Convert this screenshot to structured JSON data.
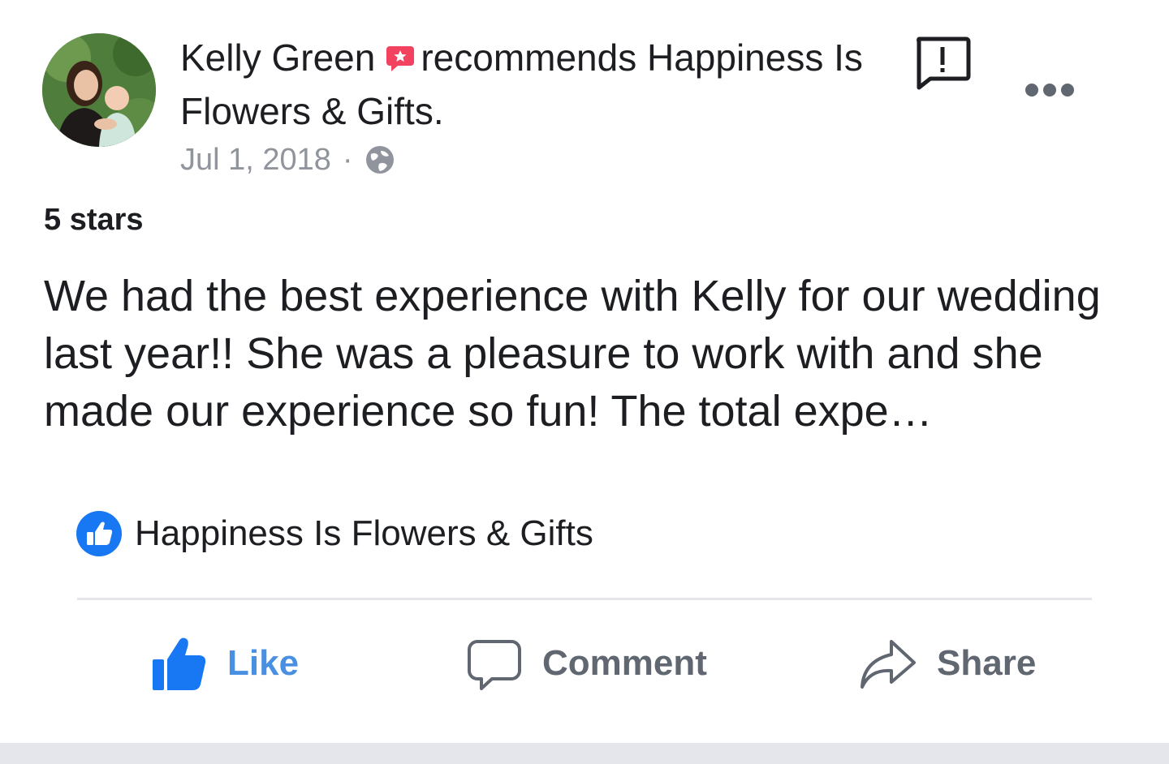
{
  "post": {
    "author": "Kelly Green",
    "action_text": "recommends Happiness Is Flowers & Gifts.",
    "date": "Jul 1, 2018",
    "separator": "·",
    "privacy_icon": "globe-icon",
    "rating_text": "5 stars",
    "review_text": "We had the best experience with Kelly for our wedding last year!! She was a pleasure to work with and she made our experience so fun! The total expe…",
    "recommended_page": "Happiness Is Flowers & Gifts"
  },
  "actions": {
    "like_label": "Like",
    "comment_label": "Comment",
    "share_label": "Share"
  },
  "colors": {
    "text": "#1c1e21",
    "meta": "#90949c",
    "like_blue": "#4a90e2",
    "action_gray": "#606770",
    "recommend_badge": "#f3425f",
    "divider": "#e4e6eb"
  }
}
